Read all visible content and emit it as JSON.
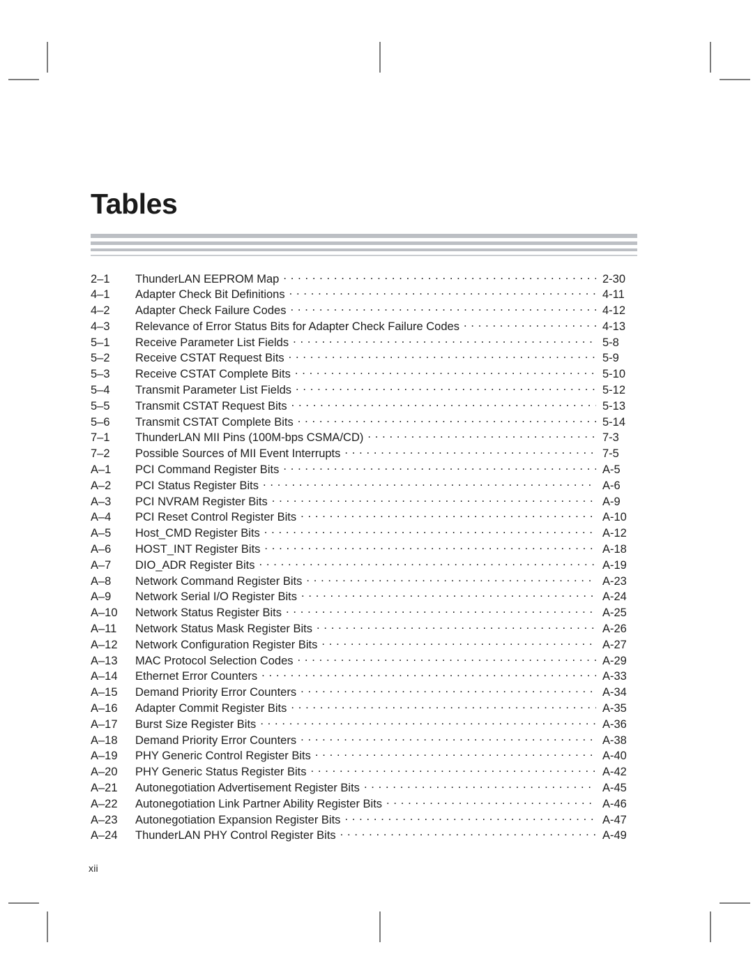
{
  "document": {
    "page_title": "Tables",
    "folio": "xii"
  },
  "toc": {
    "entries": [
      {
        "number": "2–1",
        "title": "ThunderLAN EEPROM Map",
        "page": "2-30"
      },
      {
        "number": "4–1",
        "title": "Adapter Check Bit Definitions",
        "page": "4-11"
      },
      {
        "number": "4–2",
        "title": "Adapter Check Failure Codes",
        "page": "4-12"
      },
      {
        "number": "4–3",
        "title": "Relevance of Error Status Bits for Adapter Check Failure Codes",
        "page": "4-13"
      },
      {
        "number": "5–1",
        "title": "Receive Parameter List Fields",
        "page": "5-8"
      },
      {
        "number": "5–2",
        "title": "Receive CSTAT Request Bits",
        "page": "5-9"
      },
      {
        "number": "5–3",
        "title": "Receive CSTAT Complete Bits",
        "page": "5-10"
      },
      {
        "number": "5–4",
        "title": "Transmit Parameter List Fields",
        "page": "5-12"
      },
      {
        "number": "5–5",
        "title": "Transmit CSTAT Request Bits",
        "page": "5-13"
      },
      {
        "number": "5–6",
        "title": "Transmit CSTAT Complete Bits",
        "page": "5-14"
      },
      {
        "number": "7–1",
        "title": "ThunderLAN MII Pins (100M-bps CSMA/CD)",
        "page": "7-3"
      },
      {
        "number": "7–2",
        "title": "Possible Sources of MII Event Interrupts",
        "page": "7-5"
      },
      {
        "number": "A–1",
        "title": "PCI Command Register Bits",
        "page": "A-5"
      },
      {
        "number": "A–2",
        "title": "PCI Status Register Bits",
        "page": "A-6"
      },
      {
        "number": "A–3",
        "title": "PCI NVRAM Register Bits",
        "page": "A-9"
      },
      {
        "number": "A–4",
        "title": "PCI Reset Control Register Bits",
        "page": "A-10"
      },
      {
        "number": "A–5",
        "title": "Host_CMD Register Bits",
        "page": "A-12"
      },
      {
        "number": "A–6",
        "title": "HOST_INT Register Bits",
        "page": "A-18"
      },
      {
        "number": "A–7",
        "title": "DIO_ADR Register Bits",
        "page": "A-19"
      },
      {
        "number": "A–8",
        "title": "Network Command Register Bits",
        "page": "A-23"
      },
      {
        "number": "A–9",
        "title": "Network Serial I/O Register Bits",
        "page": "A-24"
      },
      {
        "number": "A–10",
        "title": "Network Status Register Bits",
        "page": "A-25"
      },
      {
        "number": "A–11",
        "title": "Network Status Mask Register Bits",
        "page": "A-26"
      },
      {
        "number": "A–12",
        "title": "Network Configuration Register Bits",
        "page": "A-27"
      },
      {
        "number": "A–13",
        "title": "MAC Protocol Selection Codes",
        "page": "A-29"
      },
      {
        "number": "A–14",
        "title": "Ethernet Error Counters",
        "page": "A-33"
      },
      {
        "number": "A–15",
        "title": "Demand Priority Error Counters",
        "page": "A-34"
      },
      {
        "number": "A–16",
        "title": "Adapter Commit Register Bits",
        "page": "A-35"
      },
      {
        "number": "A–17",
        "title": "Burst Size Register Bits",
        "page": "A-36"
      },
      {
        "number": "A–18",
        "title": "Demand Priority Error Counters",
        "page": "A-38"
      },
      {
        "number": "A–19",
        "title": "PHY Generic Control Register Bits",
        "page": "A-40"
      },
      {
        "number": "A–20",
        "title": "PHY Generic Status Register Bits",
        "page": "A-42"
      },
      {
        "number": "A–21",
        "title": "Autonegotiation Advertisement Register Bits",
        "page": "A-45"
      },
      {
        "number": "A–22",
        "title": "Autonegotiation Link Partner Ability Register Bits",
        "page": "A-46"
      },
      {
        "number": "A–23",
        "title": "Autonegotiation Expansion Register Bits",
        "page": "A-47"
      },
      {
        "number": "A–24",
        "title": "ThunderLAN PHY Control Register Bits",
        "page": "A-49"
      }
    ]
  },
  "colors": {
    "rule": "#bcbfc4",
    "crop_mark": "#7b7b7b",
    "text": "#1c1c1c"
  }
}
